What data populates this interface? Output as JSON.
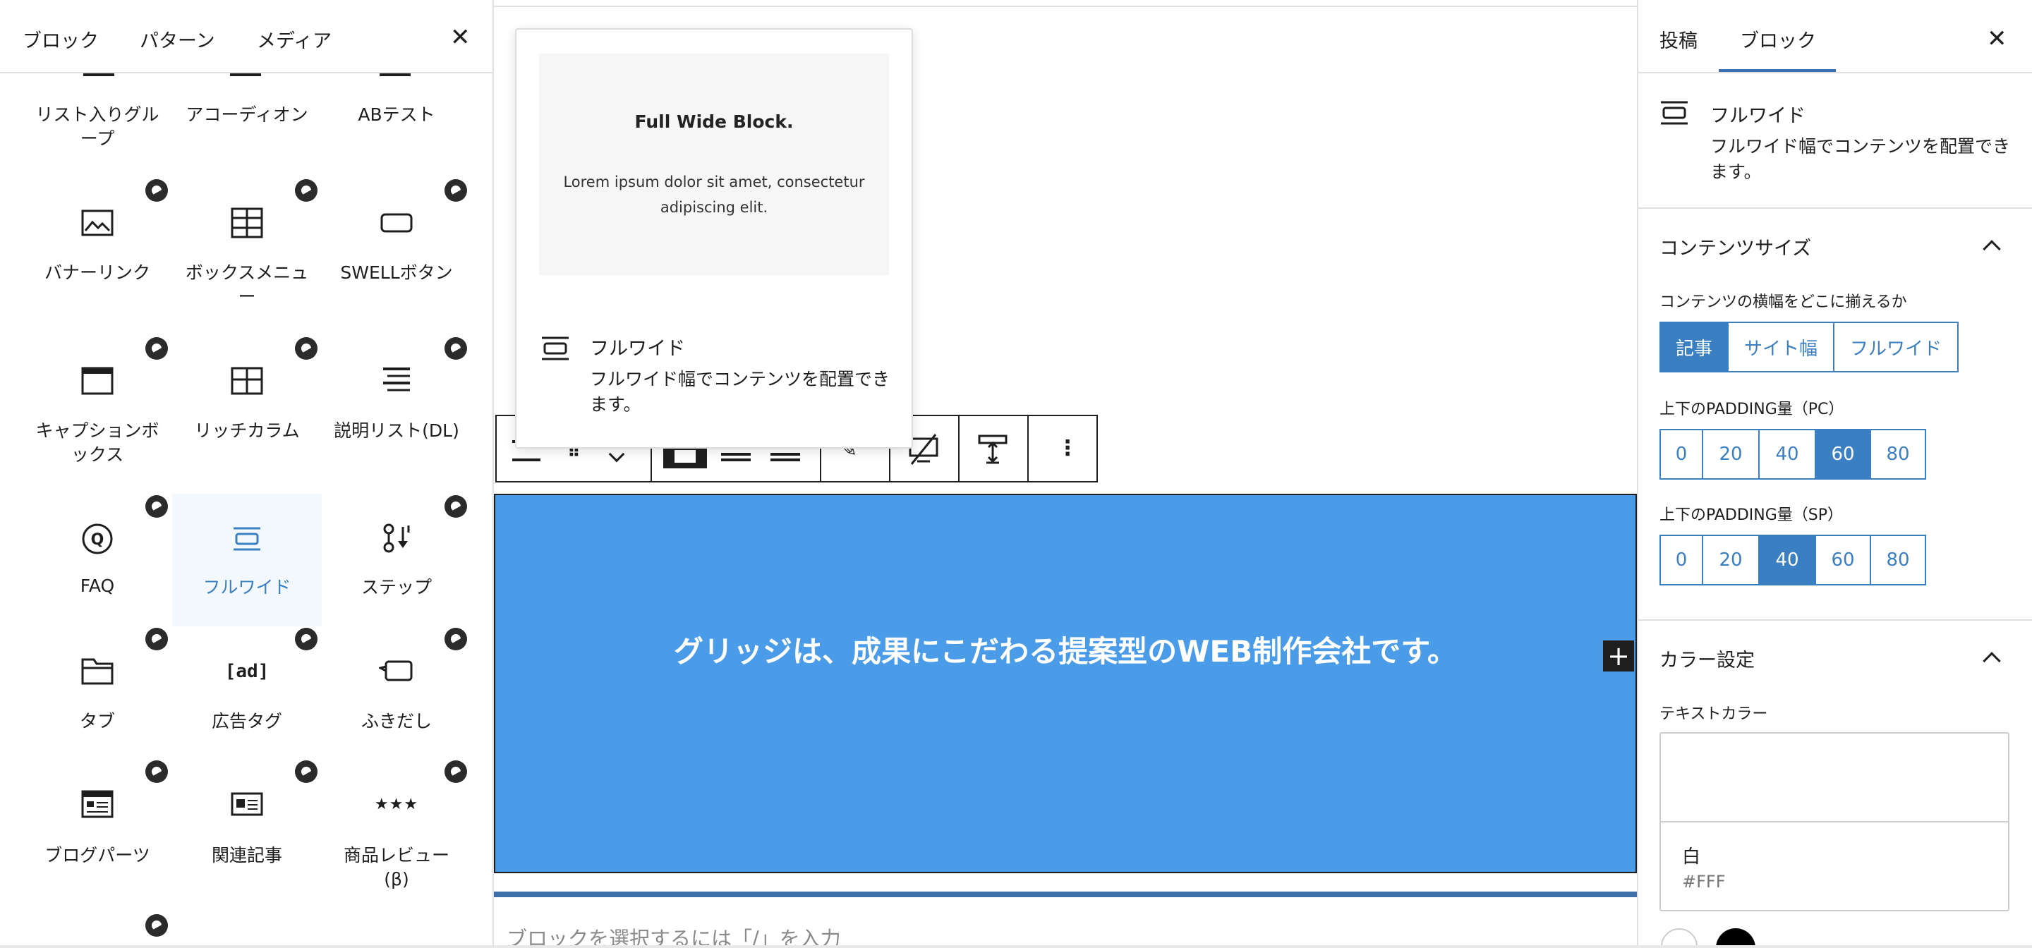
{
  "inserter": {
    "tabs": [
      "ブロック",
      "パターン",
      "メディア"
    ],
    "rows": [
      [
        "リスト入りグル\nープ",
        "アコーディオン",
        "ABテスト"
      ],
      [
        "バナーリンク",
        "ボックスメニュ\nー",
        "SWELLボタン"
      ],
      [
        "キャプションボ\nックス",
        "リッチカラム",
        "説明リスト(DL)"
      ],
      [
        "FAQ",
        "フルワイド",
        "ステップ"
      ],
      [
        "タブ",
        "広告タグ",
        "ふきだし"
      ],
      [
        "ブログパーツ",
        "関連記事",
        "商品レビュー\n(β)"
      ]
    ],
    "selected": "フルワイド",
    "icons": {
      "banner": "image-icon",
      "boxmenu": "grid-icon",
      "button": "button-icon",
      "caption": "caption-box-icon",
      "richcol": "columns-icon",
      "dl": "list-icon",
      "faq": "faq-icon",
      "fullwide": "fullwide-icon",
      "step": "step-icon",
      "tab": "tab-icon",
      "ad": "ad-tag-icon",
      "balloon": "balloon-icon",
      "blogparts": "blog-parts-icon",
      "related": "related-posts-icon",
      "review": "review-stars-icon"
    },
    "ad_glyph": "[ad]"
  },
  "preview": {
    "title": "Full Wide Block.",
    "text": "Lorem ipsum dolor sit amet, consectetur adipiscing elit.",
    "block_name": "フルワイド",
    "block_desc": "フルワイド幅でコンテンツを配置できます。"
  },
  "canvas": {
    "heading": "グリッジは、成果にこだわる提案型のWEB制作会社です。",
    "placeholder": "ブロックを選択するには「/」を入力",
    "block_bg": "#4a9ce8"
  },
  "sidebar": {
    "tabs": [
      "投稿",
      "ブロック"
    ],
    "active_tab": "ブロック",
    "block_name": "フルワイド",
    "block_desc": "フルワイド幅でコンテンツを配置できます。",
    "content_size": {
      "title": "コンテンツサイズ",
      "label": "コンテンツの横幅をどこに揃えるか",
      "options": [
        "記事",
        "サイト幅",
        "フルワイド"
      ],
      "selected": "記事"
    },
    "padding_pc": {
      "label": "上下のPADDING量（PC）",
      "options": [
        "0",
        "20",
        "40",
        "60",
        "80"
      ],
      "selected": "60"
    },
    "padding_sp": {
      "label": "上下のPADDING量（SP）",
      "options": [
        "0",
        "20",
        "40",
        "60",
        "80"
      ],
      "selected": "40"
    },
    "color": {
      "title": "カラー設定",
      "text_color_label": "テキストカラー",
      "color_name": "白",
      "color_hex": "#FFF"
    }
  },
  "accent": "#3a7fc1"
}
